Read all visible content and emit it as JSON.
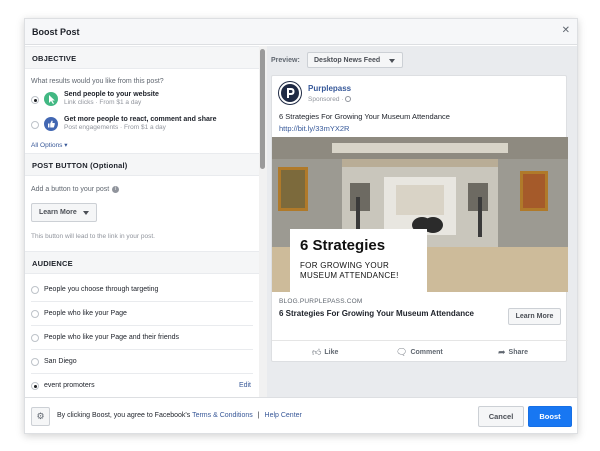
{
  "dialog": {
    "title": "Boost Post",
    "close_glyph": "✕"
  },
  "objective": {
    "heading": "OBJECTIVE",
    "question": "What results would you like from this post?",
    "options": [
      {
        "title": "Send people to your website",
        "subtitle": "Link clicks · From $1 a day",
        "selected": true,
        "icon": "cursor-icon",
        "icon_color": "#42b883"
      },
      {
        "title": "Get more people to react, comment and share",
        "subtitle": "Post engagements · From $1 a day",
        "selected": false,
        "icon": "thumbs-up-icon",
        "icon_color": "#4267b2"
      }
    ],
    "all_options": "All Options ▾"
  },
  "post_button": {
    "heading": "POST BUTTON (Optional)",
    "label": "Add a button to your post",
    "button_value": "Learn More",
    "note": "This button will lead to the link in your post."
  },
  "audience": {
    "heading": "AUDIENCE",
    "items": [
      {
        "label": "People you choose through targeting",
        "selected": false
      },
      {
        "label": "People who like your Page",
        "selected": false
      },
      {
        "label": "People who like your Page and their friends",
        "selected": false
      },
      {
        "label": "San Diego",
        "selected": false
      },
      {
        "label": "event promoters",
        "selected": true
      }
    ],
    "edit_label": "Edit"
  },
  "preview": {
    "label": "Preview:",
    "feed_option": "Desktop News Feed",
    "post": {
      "page_name": "Purplepass",
      "sponsored": "Sponsored ·",
      "text": "6 Strategies For Growing Your Museum Attendance",
      "link": "http://bit.ly/33mYX2R",
      "overlay_title": "6 Strategies",
      "overlay_sub_1": "FOR GROWING YOUR",
      "overlay_sub_2": "MUSEUM ATTENDANCE!",
      "domain": "BLOG.PURPLEPASS.COM",
      "headline": "6 Strategies For Growing Your Museum Attendance",
      "cta": "Learn More",
      "actions": {
        "like": "Like",
        "comment": "Comment",
        "share": "Share"
      }
    }
  },
  "footer": {
    "terms_prefix": "By clicking Boost, you agree to Facebook's",
    "terms_link": "Terms & Conditions",
    "separator": "|",
    "help_link": "Help Center",
    "cancel": "Cancel",
    "boost": "Boost"
  },
  "colors": {
    "accent": "#1877f2",
    "link": "#385898"
  }
}
